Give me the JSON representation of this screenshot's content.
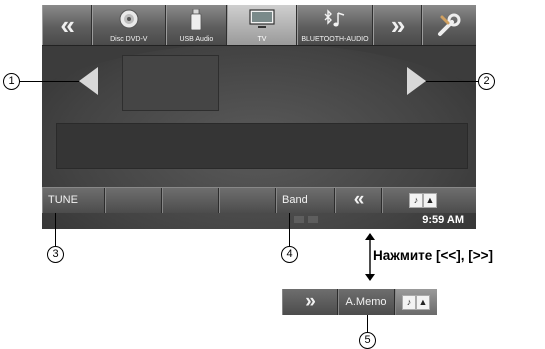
{
  "top_bar": {
    "left_scroll": "«",
    "sources": [
      {
        "label": "Disc DVD-V",
        "icon": "disc-icon"
      },
      {
        "label": "USB Audio",
        "icon": "usb-icon"
      },
      {
        "label": "TV",
        "icon": "tv-icon",
        "active": true
      },
      {
        "label": "BLUETOOTH-AUDIO",
        "icon": "bluetooth-music-icon"
      }
    ],
    "right_scroll": "»",
    "setup_icon": "settings-tools-icon"
  },
  "bottom_bar": {
    "tune": "TUNE",
    "band": "Band",
    "back": "«"
  },
  "status": {
    "clock": "9:59 AM"
  },
  "callouts": {
    "c1": "1",
    "c2": "2",
    "c3": "3",
    "c4": "4",
    "c5": "5"
  },
  "instruction": "Нажмите [<<], [>>]",
  "sub_bar": {
    "forward": "»",
    "memo": "A.Memo"
  },
  "colors": {
    "screen_bg": "#3c3c3c",
    "bar_bg": "#5e5e5e",
    "active_tab": "#cfcfcf"
  }
}
